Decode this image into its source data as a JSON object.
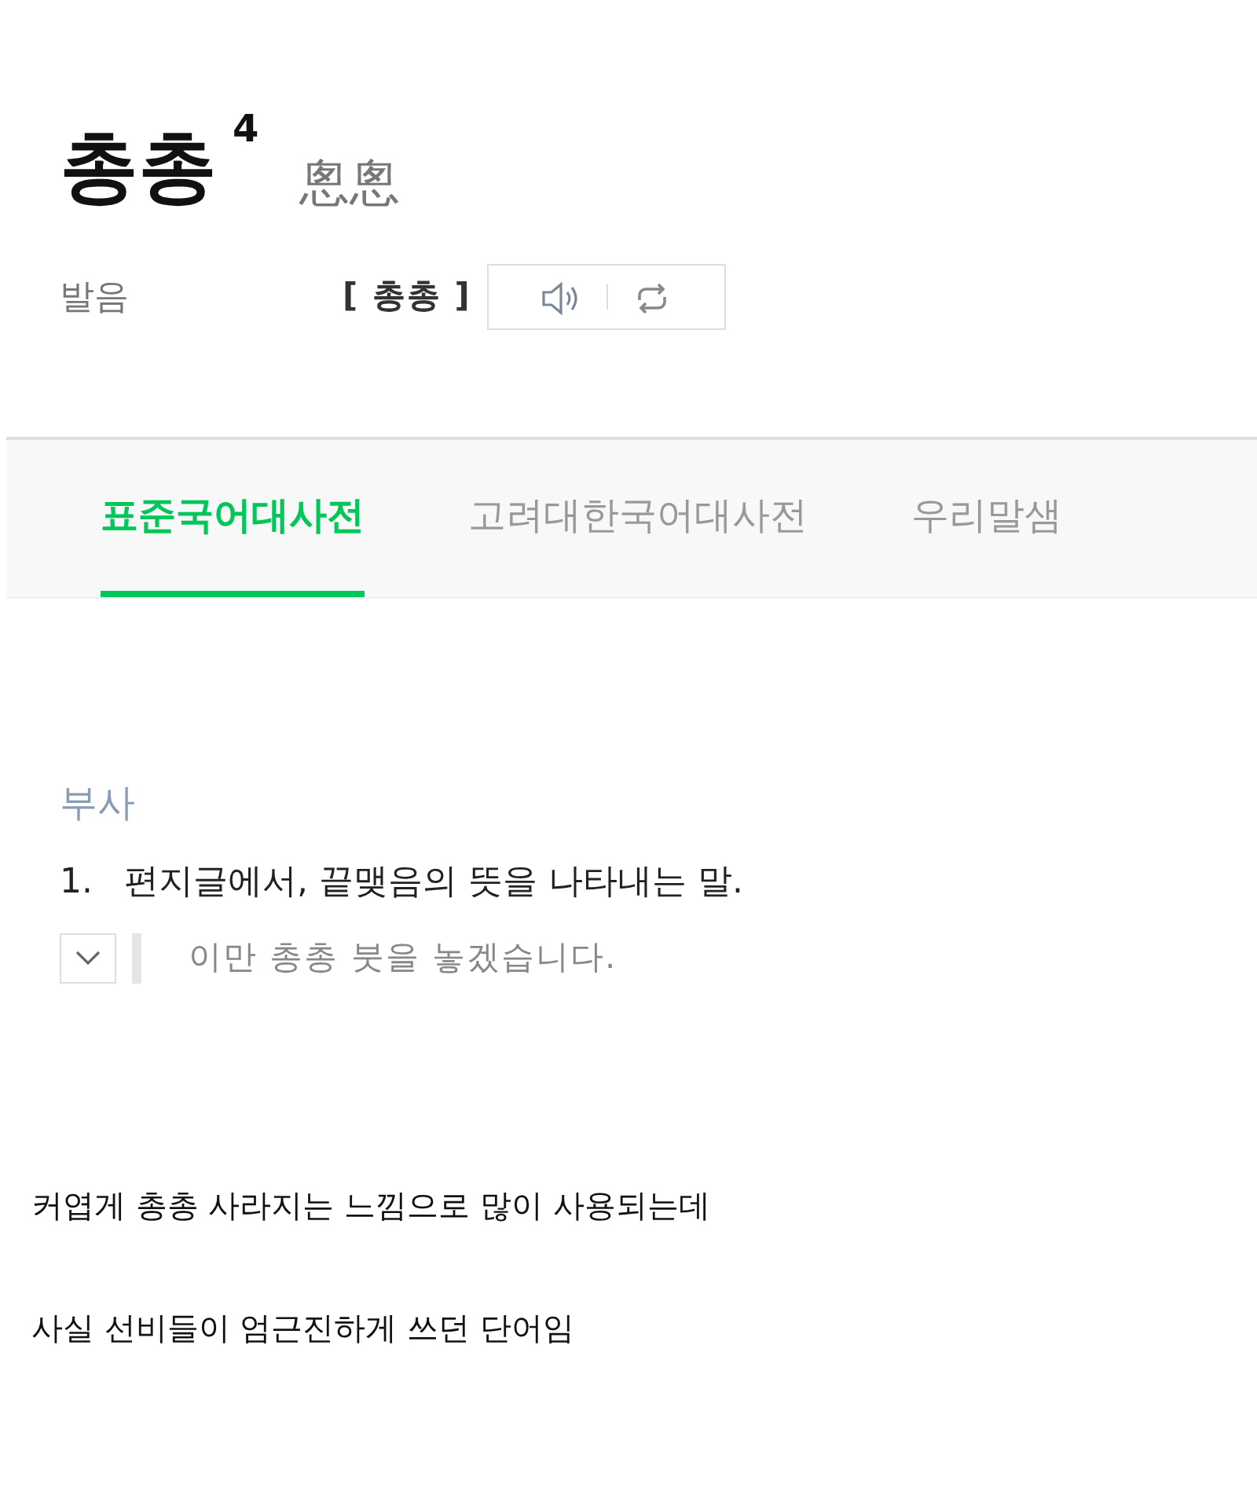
{
  "entry": {
    "word": "총총",
    "homonym_number": "4",
    "hanja": "悤悤"
  },
  "pronunciation": {
    "label": "발음",
    "reading": "[ 총총 ]"
  },
  "tabs": [
    {
      "label": "표준국어대사전",
      "selected": true
    },
    {
      "label": "고려대한국어대사전",
      "selected": false
    },
    {
      "label": "우리말샘",
      "selected": false
    }
  ],
  "definition": {
    "part_of_speech": "부사",
    "number": "1.",
    "text": "편지글에서, 끝맺음의 뜻을 나타내는 말.",
    "example": "이만 총총 붓을 놓겠습니다.",
    "example_expanded": false
  },
  "comments": [
    {
      "text": "커엽게 총총 사라지는 느낌으로 많이 사용되는데"
    },
    {
      "text": "사실 선비들이 엄근진하게 쓰던 단어임"
    }
  ]
}
